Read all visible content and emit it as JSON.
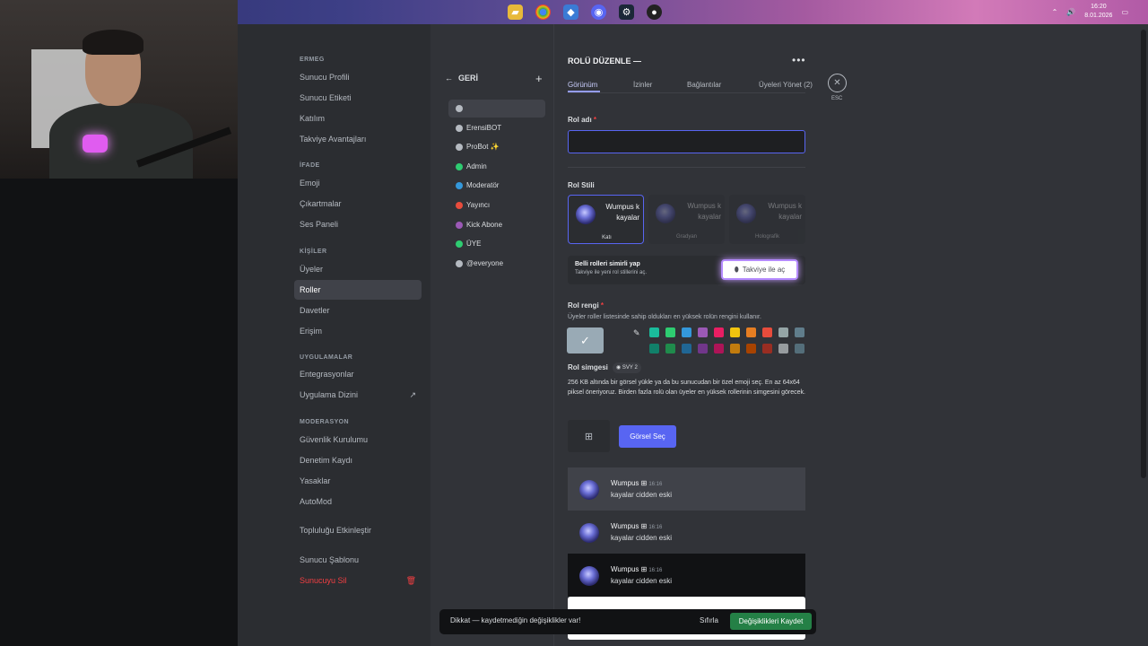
{
  "taskbar": {
    "icons": [
      "folder-icon",
      "chrome-icon",
      "app-icon",
      "discord-icon",
      "steam-icon",
      "obs-icon"
    ],
    "clock_time": "16:20",
    "clock_date": "8.01.2026"
  },
  "sidebar": {
    "sections": [
      {
        "title": "ERMEG",
        "items": [
          "Sunucu Profili",
          "Sunucu Etiketi",
          "Katılım",
          "Takviye Avantajları"
        ]
      },
      {
        "title": "İFADE",
        "items": [
          "Emoji",
          "Çıkartmalar",
          "Ses Paneli"
        ]
      },
      {
        "title": "KİŞİLER",
        "items": [
          "Üyeler",
          "Roller",
          "Davetler",
          "Erişim"
        ]
      },
      {
        "title": "UYGULAMALAR",
        "items": [
          "Entegrasyonlar",
          "Uygulama Dizini"
        ]
      },
      {
        "title": "MODERASYON",
        "items": [
          "Güvenlik Kurulumu",
          "Denetim Kaydı",
          "Yasaklar",
          "AutoMod"
        ]
      }
    ],
    "extra_items": [
      "Topluluğu Etkinleştir",
      "Sunucu Şablonu",
      "Sunucuyu Sil"
    ],
    "active_item": "Roller"
  },
  "roles": {
    "back_label": "GERİ",
    "items": [
      {
        "name": "",
        "color": "#b5bac1"
      },
      {
        "name": "ErensiBOT",
        "color": "#b5bac1"
      },
      {
        "name": "ProBot ✨",
        "color": "#b5bac1"
      },
      {
        "name": "Admin",
        "color": "#2ecc71"
      },
      {
        "name": "Moderatör",
        "color": "#3498db"
      },
      {
        "name": "Yayıncı",
        "color": "#e74c3c"
      },
      {
        "name": "Kick Abone",
        "color": "#9b59b6"
      },
      {
        "name": "ÜYE",
        "color": "#2ecc71"
      },
      {
        "name": "@everyone",
        "color": "#b5bac1"
      }
    ]
  },
  "editor": {
    "title": "ROLÜ DÜZENLE —",
    "tabs": [
      "Görünüm",
      "İzinler",
      "Bağlantılar",
      "Üyeleri Yönet (2)"
    ],
    "esc_label": "ESC",
    "role_name_label": "Rol adı",
    "role_name_value": "",
    "role_style_label": "Rol Stili",
    "style_cards": [
      {
        "line1": "Wumpus k",
        "line2": "kayalar",
        "label": "Katı"
      },
      {
        "line1": "Wumpus k",
        "line2": "kayalar",
        "label": "Gradyan"
      },
      {
        "line1": "Wumpus k",
        "line2": "kayalar",
        "label": "Holografik"
      }
    ],
    "boost_title": "Belli rolleri simirli yap",
    "boost_sub": "Takviye ile yeni rol stillerini aç.",
    "boost_button": "Takviye ile aç",
    "color_label": "Rol rengi",
    "color_sub": "Üyeler roller listesinde sahip oldukları en yüksek rolün rengini kullanır.",
    "selected_color": "#99aab5",
    "swatches_top": [
      "#1abc9c",
      "#2ecc71",
      "#3498db",
      "#9b59b6",
      "#e91e63",
      "#f1c40f",
      "#e67e22",
      "#e74c3c",
      "#95a5a6",
      "#607d8b"
    ],
    "swatches_bottom": [
      "#11806a",
      "#1f8b4c",
      "#206694",
      "#71368a",
      "#ad1457",
      "#c27c0e",
      "#a84300",
      "#992d22",
      "#979c9f",
      "#546e7a"
    ],
    "icon_label": "Rol simgesi",
    "icon_badge": "SVY 2",
    "icon_desc": "256 KB altında bir görsel yükle ya da bu sunucudan bir özel emoji seç. En az 64x64 piksel öneriyoruz. Birden fazla rolü olan üyeler en yüksek rollerinin simgesini görecek.",
    "choose_button": "Görsel Seç",
    "previews": [
      {
        "name": "Wumpus",
        "time": "16:16",
        "message": "kayalar cidden eski"
      },
      {
        "name": "Wumpus",
        "time": "16:16",
        "message": "kayalar cidden eski"
      },
      {
        "name": "Wumpus",
        "time": "16:16",
        "message": "kayalar cidden eski"
      }
    ]
  },
  "toast": {
    "text": "Dikkat — kaydetmediğin değişiklikler var!",
    "reset": "Sıfırla",
    "save": "Değişiklikleri Kaydet"
  }
}
